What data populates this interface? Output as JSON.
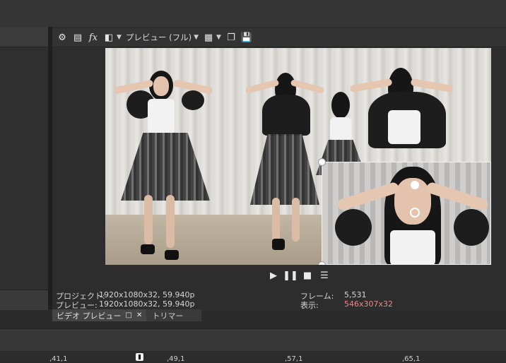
{
  "toolbar": {
    "icons": [
      "gear-icon",
      "properties-icon",
      "fx-icon",
      "split-screen-icon",
      "grid-icon",
      "copy-snapshot-icon",
      "save-snapshot-icon"
    ],
    "fx_label": "fx",
    "preview_quality": "プレビュー (フル)"
  },
  "transport": {
    "buttons": [
      "play",
      "pause",
      "stop",
      "menu"
    ]
  },
  "info": {
    "project_label": "プロジェクト:",
    "project_value": "1920x1080x32, 59.940p",
    "preview_label": "プレビュー:",
    "preview_value": "1920x1080x32, 59.940p",
    "frame_label": "フレーム:",
    "frame_value": "5,531",
    "display_label": "表示:",
    "display_value": "546x307x32"
  },
  "tabs": {
    "video_preview": "ビデオ プレビュー",
    "trimmer": "トリマー"
  },
  "ruler": {
    "ticks": [
      ",41,1",
      ",49,1",
      ",57,1",
      ",65,1"
    ]
  },
  "colors": {
    "display_value": "#e88a8a",
    "background": "#2b2b2b"
  }
}
